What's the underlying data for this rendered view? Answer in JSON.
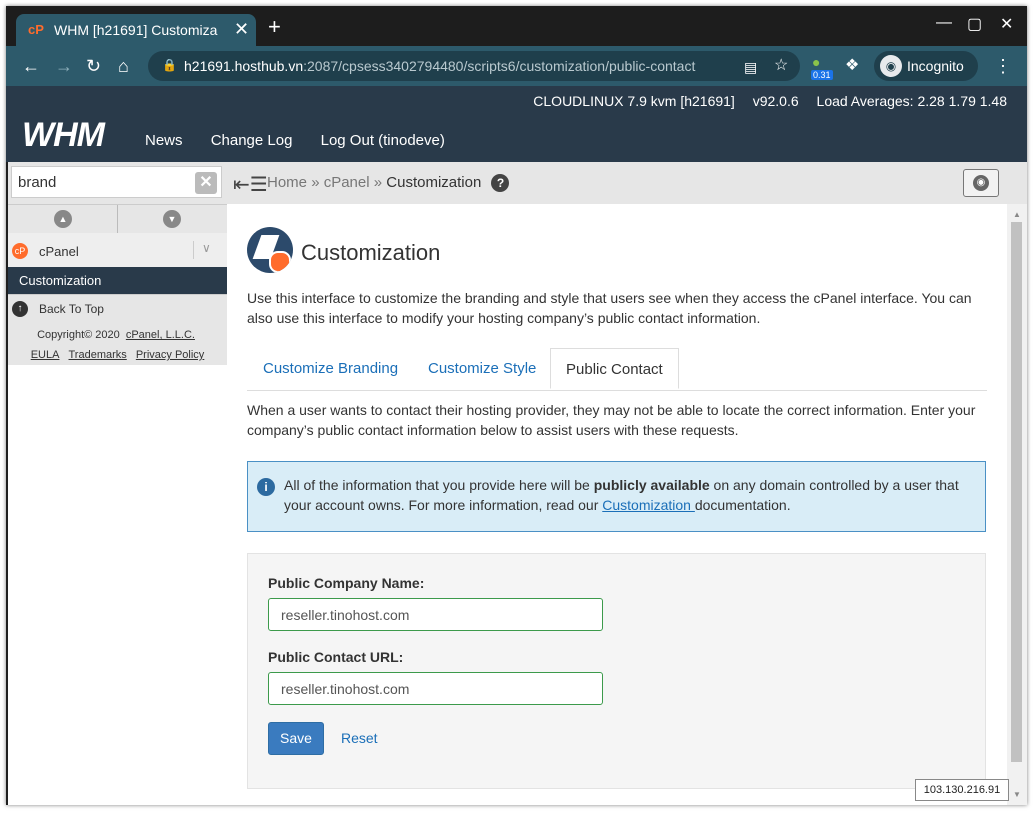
{
  "browser": {
    "tab_title": "WHM [h21691] Customiza",
    "url_host": "h21691.hosthub.vn",
    "url_rest": ":2087/cpsess3402794480/scripts6/customization/public-contact",
    "extension_badge": "0.31",
    "incognito_label": "Incognito",
    "new_tab": "+",
    "tab_close": "✕"
  },
  "header": {
    "os": "CLOUDLINUX 7.9 kvm [h21691]",
    "version": "v92.0.6",
    "load": "Load Averages: 2.28 1.79 1.48",
    "logo": "WHM",
    "nav": [
      "News",
      "Change Log",
      "Log Out (tinodeve)"
    ]
  },
  "sidebar": {
    "search_value": "brand",
    "group": "cPanel",
    "active_item": "Customization",
    "back_to_top": "Back To Top",
    "copyright": "Copyright© 2020",
    "company": "cPanel, L.L.C.",
    "links": [
      "EULA",
      "Trademarks",
      "Privacy Policy"
    ]
  },
  "breadcrumb": {
    "items": [
      "Home",
      "cPanel",
      "Customization"
    ],
    "sep": "»"
  },
  "main": {
    "title": "Customization",
    "description": "Use this interface to customize the branding and style that users see when they access the cPanel interface. You can also use this interface to modify your hosting company’s public contact information.",
    "tabs": [
      "Customize Branding",
      "Customize Style",
      "Public Contact"
    ],
    "active_tab": "Public Contact",
    "intro": "When a user wants to contact their hosting provider, they may not be able to locate the correct information. Enter your company’s public contact information below to assist users with these requests.",
    "alert": {
      "pre": "All of the information that you provide here will be ",
      "bold": "publicly available",
      "mid": " on any domain controlled by a user that your account owns. For more information, read our ",
      "link": "Customization ",
      "post": " documentation."
    },
    "form": {
      "company_label": "Public Company Name:",
      "company_value": "reseller.tinohost.com",
      "url_label": "Public Contact URL:",
      "url_value": "reseller.tinohost.com",
      "save": "Save",
      "reset": "Reset"
    }
  },
  "ip_address": "103.130.216.91",
  "colors": {
    "header_bg": "#293a4a",
    "browser_accent": "#2d5a6b",
    "link": "#1b6fb8",
    "save_button": "#3a7bbf",
    "alert_bg": "#d9edf7",
    "cpanel_orange": "#ff6c2c"
  }
}
